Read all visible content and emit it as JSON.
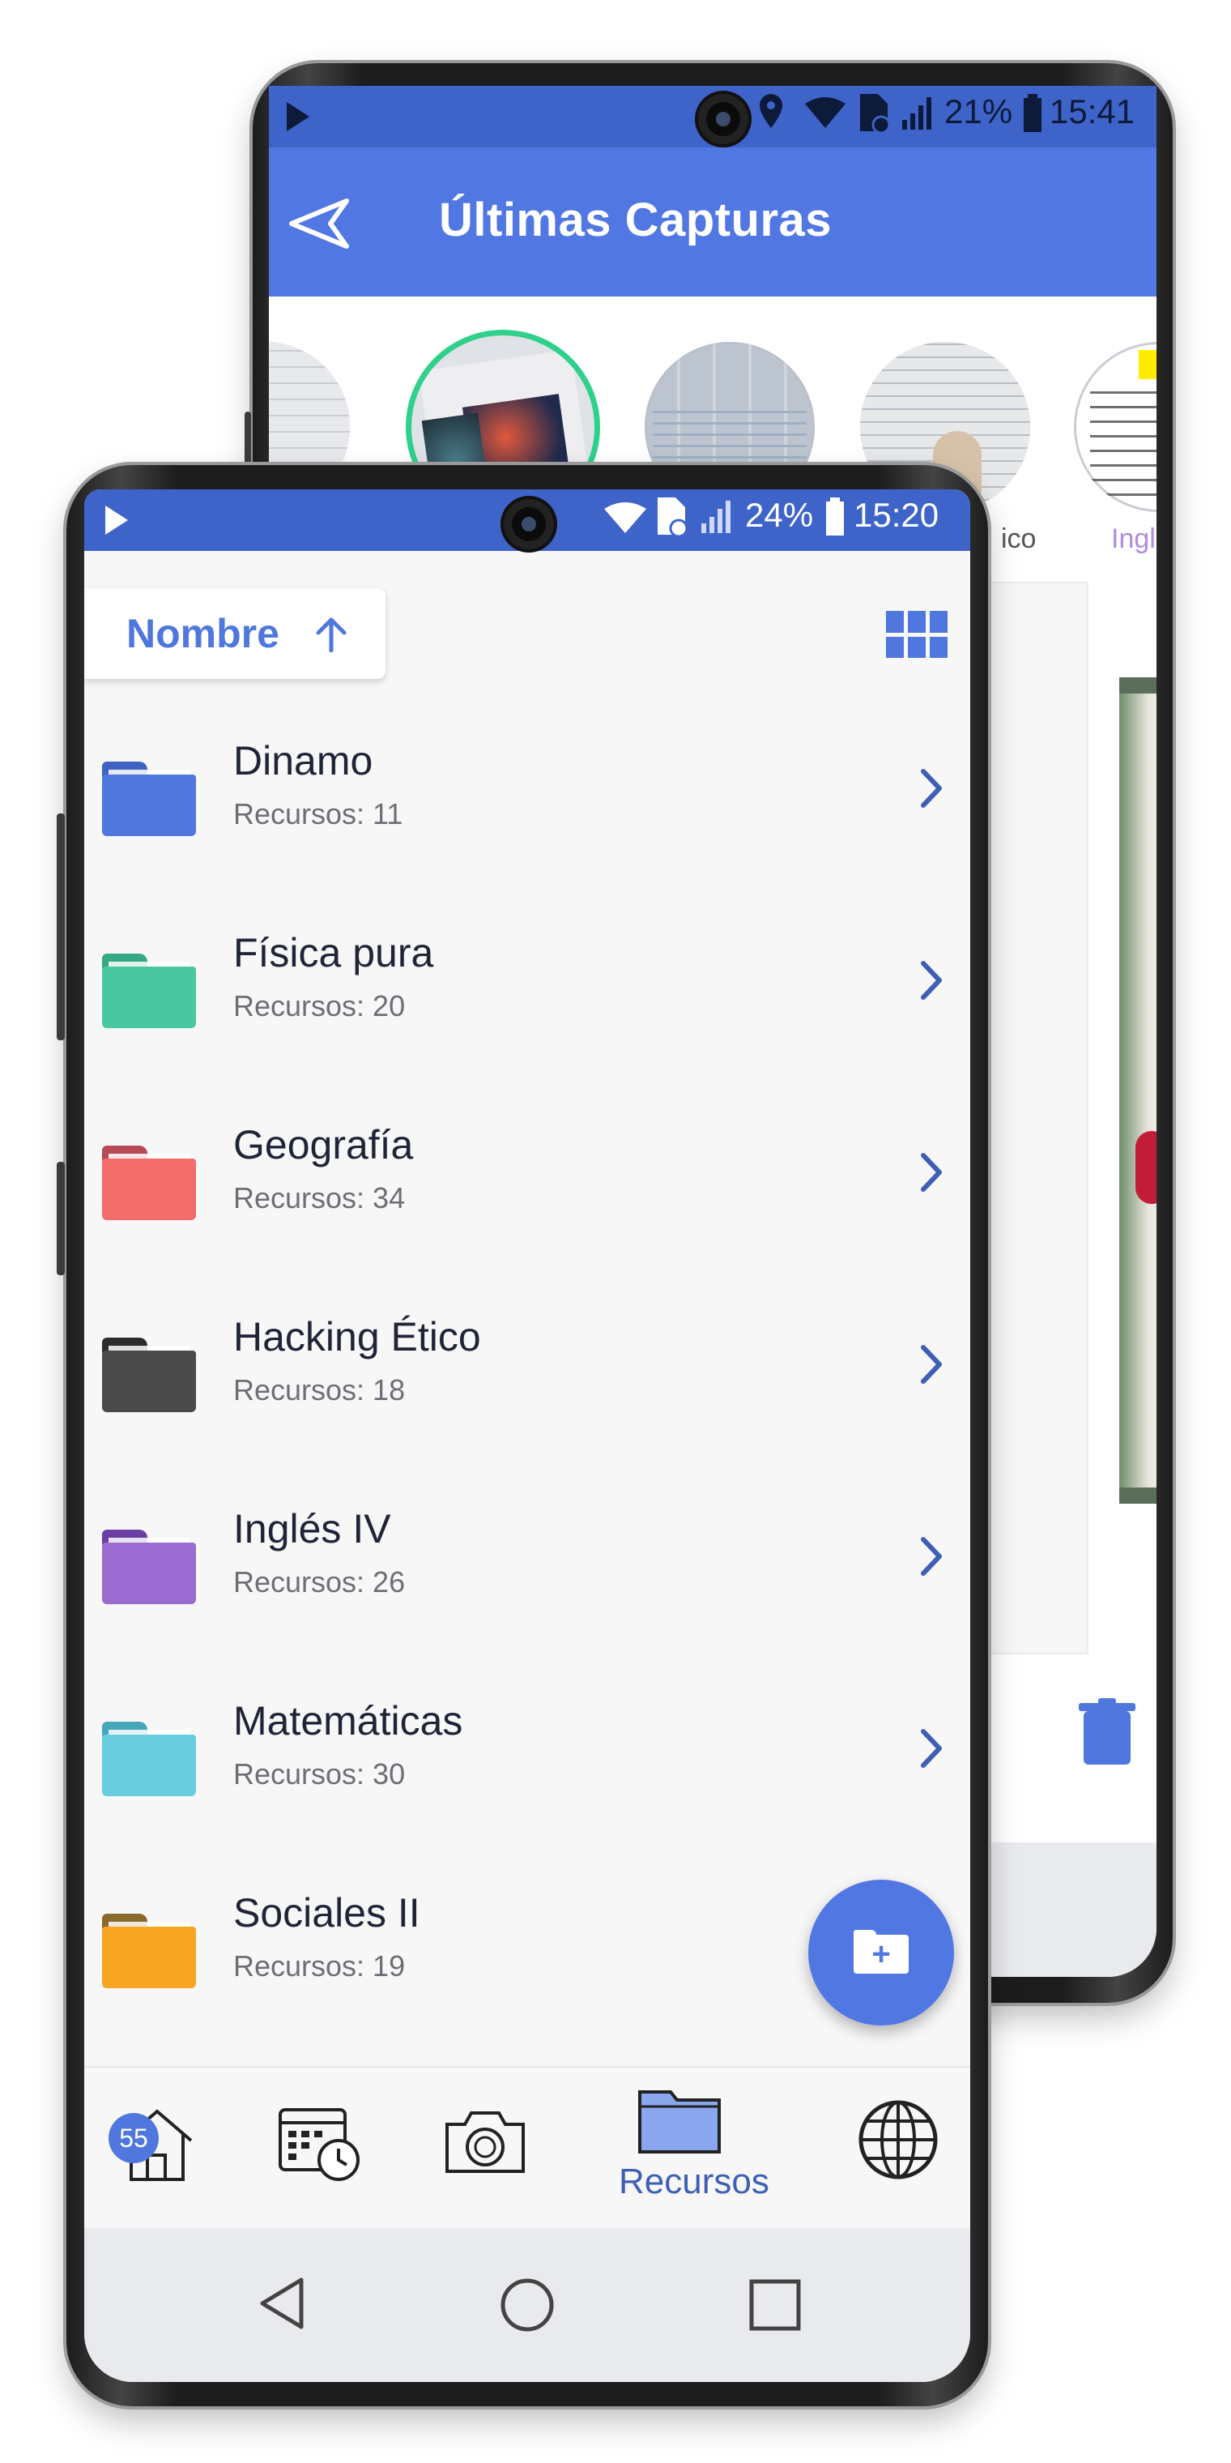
{
  "back_screen": {
    "status_bar": {
      "battery": "21%",
      "time": "15:41"
    },
    "app_bar": {
      "title": "Últimas Capturas",
      "back_icon": "send-arrow-icon"
    },
    "captures": [
      {
        "label": ""
      },
      {
        "label": ""
      },
      {
        "label": ""
      },
      {
        "label": "ico"
      },
      {
        "label": "Inglé"
      }
    ],
    "preview_card_visible": true,
    "delete_icon": "trash-icon"
  },
  "front_screen": {
    "status_bar": {
      "battery": "24%",
      "time": "15:20"
    },
    "sort": {
      "label": "Nombre",
      "direction_icon": "arrow-up-icon"
    },
    "view_toggle_icon": "grid-view-icon",
    "folders": [
      {
        "name": "Dinamo",
        "count": "Recursos: 11",
        "color": "#4f77dd"
      },
      {
        "name": "Física pura",
        "count": "Recursos: 20",
        "color": "#48c7a1"
      },
      {
        "name": "Geografía",
        "count": "Recursos: 34",
        "color": "#f46b6b"
      },
      {
        "name": "Hacking Ético",
        "count": "Recursos: 18",
        "color": "#4a4a4a"
      },
      {
        "name": "Inglés IV",
        "count": "Recursos: 26",
        "color": "#9a6bd1"
      },
      {
        "name": "Matemáticas",
        "count": "Recursos: 30",
        "color": "#69cde0"
      },
      {
        "name": "Sociales II",
        "count": "Recursos: 19",
        "color": "#f6a623"
      }
    ],
    "fab_icon": "add-folder-icon",
    "bottom_nav": {
      "badge": "55",
      "active_label": "Recursos",
      "items": [
        "home-icon",
        "calendar-clock-icon",
        "camera-icon",
        "folder-icon",
        "globe-icon"
      ]
    },
    "system_nav": [
      "back-triangle-icon",
      "home-circle-icon",
      "recents-square-icon"
    ]
  },
  "colors": {
    "primary": "#5177e3",
    "status_bar": "#3e63c9",
    "accent_green": "#2fd08a"
  }
}
